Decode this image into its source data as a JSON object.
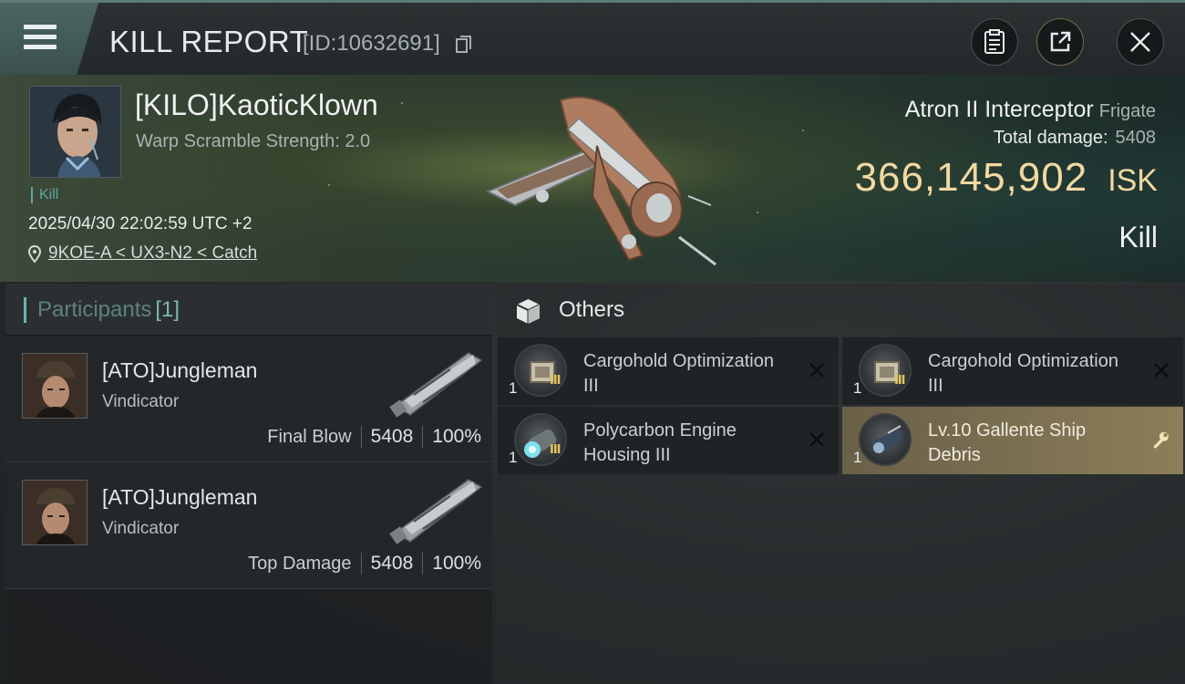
{
  "header": {
    "title": "KILL REPORT",
    "report_id": "[ID:10632691]",
    "menu_icon": "hamburger-menu-icon",
    "copy_icon": "copy-icon",
    "buttons": [
      {
        "name": "clipboard-icon"
      },
      {
        "name": "share-icon"
      },
      {
        "name": "close-icon"
      }
    ]
  },
  "victim": {
    "name": "[KILO]KaoticKlown",
    "warp_scramble": "Warp Scramble Strength: 2.0",
    "kill_tag": "Kill",
    "timestamp": "2025/04/30 22:02:59 UTC +2",
    "location": "9KOE-A < UX3-N2 < Catch",
    "ship_name": "Atron II Interceptor",
    "ship_class": "Frigate",
    "total_damage_label": "Total damage:",
    "total_damage": "5408",
    "isk_value": "366,145,902",
    "isk_unit": "ISK",
    "result": "Kill"
  },
  "participants": {
    "title": "Participants",
    "count": "[1]",
    "rows": [
      {
        "name": "[ATO]Jungleman",
        "ship": "Vindicator",
        "label": "Final Blow",
        "damage": "5408",
        "percent": "100%"
      },
      {
        "name": "[ATO]Jungleman",
        "ship": "Vindicator",
        "label": "Top Damage",
        "damage": "5408",
        "percent": "100%"
      }
    ]
  },
  "others": {
    "title": "Others",
    "items": [
      {
        "name": "Cargohold Optimization III",
        "qty": "1",
        "tier": "III",
        "action_icon": "destroyed-x-icon"
      },
      {
        "name": "Cargohold Optimization III",
        "qty": "1",
        "tier": "III",
        "action_icon": "destroyed-x-icon"
      },
      {
        "name": "Polycarbon Engine Housing III",
        "qty": "1",
        "tier": "III",
        "action_icon": "destroyed-x-icon"
      },
      {
        "name": "Lv.10 Gallente Ship Debris",
        "qty": "1",
        "tier": "",
        "action_icon": "wrench-icon"
      }
    ]
  },
  "colors": {
    "accent_teal": "#6db3b3",
    "isk_gold": "#f2d8a2",
    "dropped_item_bg": "#8c7e5a"
  }
}
